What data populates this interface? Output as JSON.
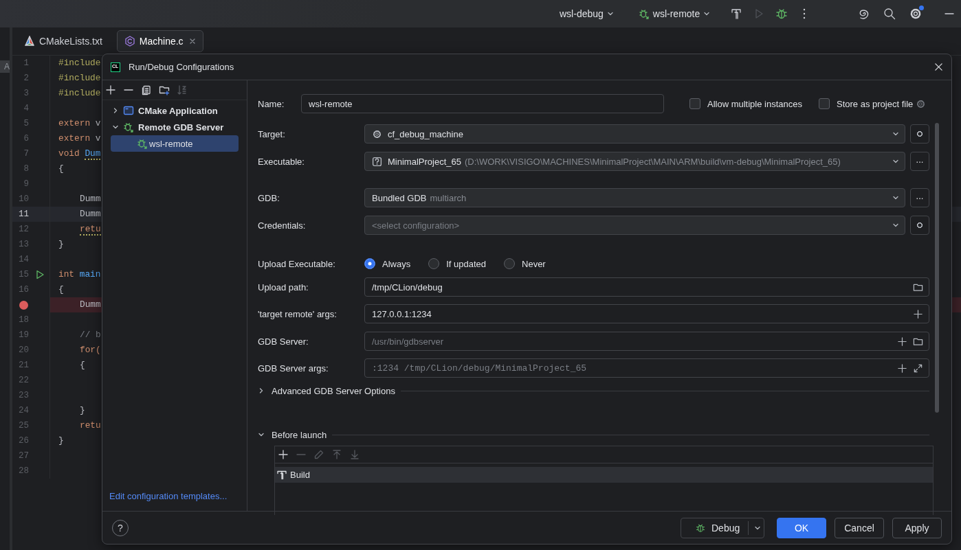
{
  "title_bar": {
    "profile": "wsl-debug",
    "run_config": "wsl-remote",
    "settings_badge": true
  },
  "editor": {
    "side_label": "A",
    "tabs": [
      {
        "label": "CMakeLists.txt",
        "kind": "cmake",
        "selected": false
      },
      {
        "label": "Machine.c",
        "kind": "c",
        "selected": true
      }
    ],
    "lines": [
      {
        "number": "1",
        "indented": false,
        "current": false,
        "breakpoint": false,
        "run": false,
        "tokens": [
          {
            "text": "#include",
            "kind": "preproc",
            "warning": false
          }
        ]
      },
      {
        "number": "2",
        "indented": false,
        "current": false,
        "breakpoint": false,
        "run": false,
        "tokens": [
          {
            "text": "#include",
            "kind": "preproc",
            "warning": false
          }
        ]
      },
      {
        "number": "3",
        "indented": false,
        "current": false,
        "breakpoint": false,
        "run": false,
        "tokens": [
          {
            "text": "#include",
            "kind": "preproc",
            "warning": false
          }
        ]
      },
      {
        "number": "4",
        "current": false,
        "breakpoint": false,
        "run": false
      },
      {
        "number": "5",
        "indented": false,
        "current": false,
        "breakpoint": false,
        "run": false,
        "tokens": [
          {
            "text": "extern",
            "kind": "keyword",
            "warning": false
          },
          {
            "text": "v",
            "kind": "plain",
            "warning": false
          }
        ]
      },
      {
        "number": "6",
        "indented": false,
        "current": false,
        "breakpoint": false,
        "run": false,
        "tokens": [
          {
            "text": "extern",
            "kind": "keyword",
            "warning": false
          },
          {
            "text": "v",
            "kind": "plain",
            "warning": false
          }
        ]
      },
      {
        "number": "7",
        "indented": false,
        "current": false,
        "breakpoint": false,
        "run": false,
        "tokens": [
          {
            "text": "void",
            "kind": "keyword",
            "warning": false
          },
          {
            "text": "Dum",
            "kind": "function",
            "warning": true
          }
        ]
      },
      {
        "number": "8",
        "indented": false,
        "current": false,
        "breakpoint": false,
        "run": false,
        "tokens": [
          {
            "text": "{",
            "kind": "plain",
            "warning": false
          }
        ]
      },
      {
        "number": "9",
        "current": false,
        "breakpoint": false,
        "run": false
      },
      {
        "number": "10",
        "indented": true,
        "current": false,
        "breakpoint": false,
        "run": false,
        "tokens": [
          {
            "text": "Dumm",
            "kind": "plain",
            "warning": false
          }
        ]
      },
      {
        "number": "11",
        "indented": true,
        "current": true,
        "breakpoint": false,
        "run": false,
        "tokens": [
          {
            "text": "Dumm",
            "kind": "plain",
            "warning": false
          }
        ]
      },
      {
        "number": "12",
        "indented": true,
        "current": false,
        "breakpoint": false,
        "run": false,
        "tokens": [
          {
            "text": "retu",
            "kind": "keyword",
            "warning": true
          }
        ]
      },
      {
        "number": "13",
        "indented": false,
        "current": false,
        "breakpoint": false,
        "run": false,
        "tokens": [
          {
            "text": "}",
            "kind": "plain",
            "warning": false
          }
        ]
      },
      {
        "number": "14",
        "current": false,
        "breakpoint": false,
        "run": false
      },
      {
        "number": "15",
        "indented": false,
        "current": false,
        "breakpoint": false,
        "run": true,
        "tokens": [
          {
            "text": "int",
            "kind": "keyword",
            "warning": false
          },
          {
            "text": "main",
            "kind": "function",
            "warning": false
          }
        ]
      },
      {
        "number": "16",
        "indented": false,
        "current": false,
        "breakpoint": false,
        "run": false,
        "tokens": [
          {
            "text": "{",
            "kind": "plain",
            "warning": false
          }
        ]
      },
      {
        "indented": true,
        "current": false,
        "breakpoint": true,
        "run": false,
        "tokens": [
          {
            "text": "Dumm",
            "kind": "plain",
            "warning": false
          }
        ]
      },
      {
        "number": "18",
        "current": false,
        "breakpoint": false,
        "run": false
      },
      {
        "number": "19",
        "indented": true,
        "current": false,
        "breakpoint": false,
        "run": false,
        "tokens": [
          {
            "text": "// b",
            "kind": "comment",
            "warning": false
          }
        ]
      },
      {
        "number": "20",
        "indented": true,
        "current": false,
        "breakpoint": false,
        "run": false,
        "tokens": [
          {
            "text": "for(",
            "kind": "keyword",
            "warning": false
          }
        ]
      },
      {
        "number": "21",
        "indented": true,
        "current": false,
        "breakpoint": false,
        "run": false,
        "tokens": [
          {
            "text": "{",
            "kind": "plain",
            "warning": false
          }
        ]
      },
      {
        "number": "22",
        "current": false,
        "breakpoint": false,
        "run": false
      },
      {
        "number": "23",
        "current": false,
        "breakpoint": false,
        "run": false
      },
      {
        "number": "24",
        "indented": true,
        "current": false,
        "breakpoint": false,
        "run": false,
        "tokens": [
          {
            "text": "}",
            "kind": "plain",
            "warning": false
          }
        ]
      },
      {
        "number": "25",
        "indented": true,
        "current": false,
        "breakpoint": false,
        "run": false,
        "tokens": [
          {
            "text": "retu",
            "kind": "keyword",
            "warning": false
          }
        ]
      },
      {
        "number": "26",
        "indented": false,
        "current": false,
        "breakpoint": false,
        "run": false,
        "tokens": [
          {
            "text": "}",
            "kind": "plain",
            "warning": false
          }
        ]
      },
      {
        "number": "27",
        "current": false,
        "breakpoint": false,
        "run": false
      },
      {
        "number": "28",
        "current": false,
        "breakpoint": false,
        "run": false
      }
    ]
  },
  "dialog": {
    "logo": "CL",
    "title": "Run/Debug Configurations",
    "tree": [
      {
        "label": "CMake Application",
        "kind": "cmake",
        "expanded": false,
        "selected": false
      },
      {
        "label": "Remote GDB Server",
        "kind": "remote",
        "expanded": true,
        "selected": false,
        "children": [
          {
            "label": "wsl-remote",
            "kind": "remote",
            "selected": true
          }
        ]
      }
    ],
    "templates_link": "Edit configuration templates...",
    "name": {
      "label": "Name:",
      "value": "wsl-remote"
    },
    "options": [
      {
        "label": "Allow multiple instances",
        "checked": false
      },
      {
        "label": "Store as project file",
        "checked": false
      }
    ],
    "target": {
      "label": "Target:",
      "value": "cf_debug_machine"
    },
    "executable": {
      "label": "Executable:",
      "value": "MinimalProject_65",
      "detail": "(D:\\WORK\\VISIGO\\MACHINES\\MinimalProject\\MAIN\\ARM\\build\\vm-debug\\MinimalProject_65)",
      "button": "..."
    },
    "gdb": {
      "label": "GDB:",
      "value": "Bundled GDB",
      "detail": "multiarch",
      "button": "..."
    },
    "credentials": {
      "label": "Credentials:",
      "placeholder": "<select configuration>"
    },
    "upload": {
      "label": "Upload Executable:",
      "options": [
        {
          "label": "Always",
          "selected": true
        },
        {
          "label": "If updated",
          "selected": false
        },
        {
          "label": "Never",
          "selected": false
        }
      ]
    },
    "upload_path": {
      "label": "Upload path:",
      "value": "/tmp/CLion/debug"
    },
    "target_remote": {
      "label": "'target remote' args:",
      "value": "127.0.0.1:1234"
    },
    "gdb_server": {
      "label": "GDB Server:",
      "placeholder": "/usr/bin/gdbserver"
    },
    "gdb_server_args": {
      "label": "GDB Server args:",
      "placeholder": ":1234 /tmp/CLion/debug/MinimalProject_65"
    },
    "advanced": {
      "label": "Advanced GDB Server Options",
      "expanded": false
    },
    "before_launch": {
      "label": "Before launch",
      "expanded": true,
      "tasks": [
        {
          "label": "Build",
          "selected": true
        }
      ]
    },
    "help": "?",
    "debug": "Debug",
    "ok": "OK",
    "cancel": "Cancel",
    "apply": "Apply"
  }
}
